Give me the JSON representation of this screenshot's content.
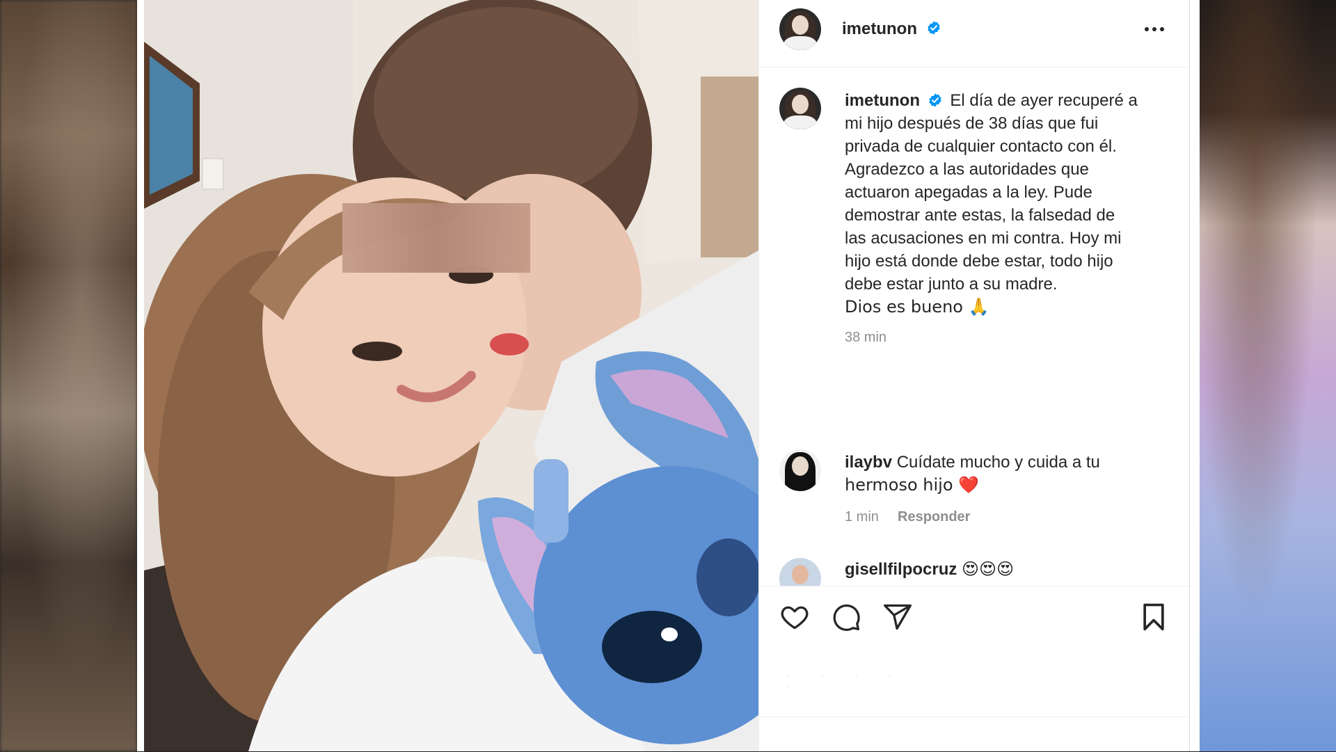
{
  "post": {
    "author": "imetunon",
    "caption_username": "imetunon",
    "caption_lines": [
      "El día de ayer recuperé a",
      "mi hijo después de 38 días que fui",
      "privada de cualquier contacto con él.",
      "Agradezco a las autoridades que",
      "actuaron apegadas a la ley. Pude",
      "demostrar ante estas, la falsedad de",
      "las acusaciones en mi contra. Hoy mi",
      "hijo está donde debe estar, todo hijo",
      "debe estar junto a su madre.",
      "Dios es bueno 🙏"
    ],
    "time": "38 min"
  },
  "comments": [
    {
      "username": "ilaybv",
      "text": "Cuídate mucho y cuida a tu",
      "text_line2": "hermoso hijo ❤️",
      "time": "1 min",
      "reply_label": "Responder"
    },
    {
      "username": "gisellfilpocruz",
      "text": "😍😍😍"
    }
  ],
  "icons": {
    "more": "more-options-icon",
    "verified": "verified-badge-icon",
    "like": "heart-icon",
    "comment": "comment-icon",
    "share": "send-icon",
    "save": "bookmark-icon"
  },
  "colors": {
    "verified": "#0095f6",
    "text": "#262626",
    "muted": "#8e8e8e",
    "heart": "#e0245e"
  }
}
